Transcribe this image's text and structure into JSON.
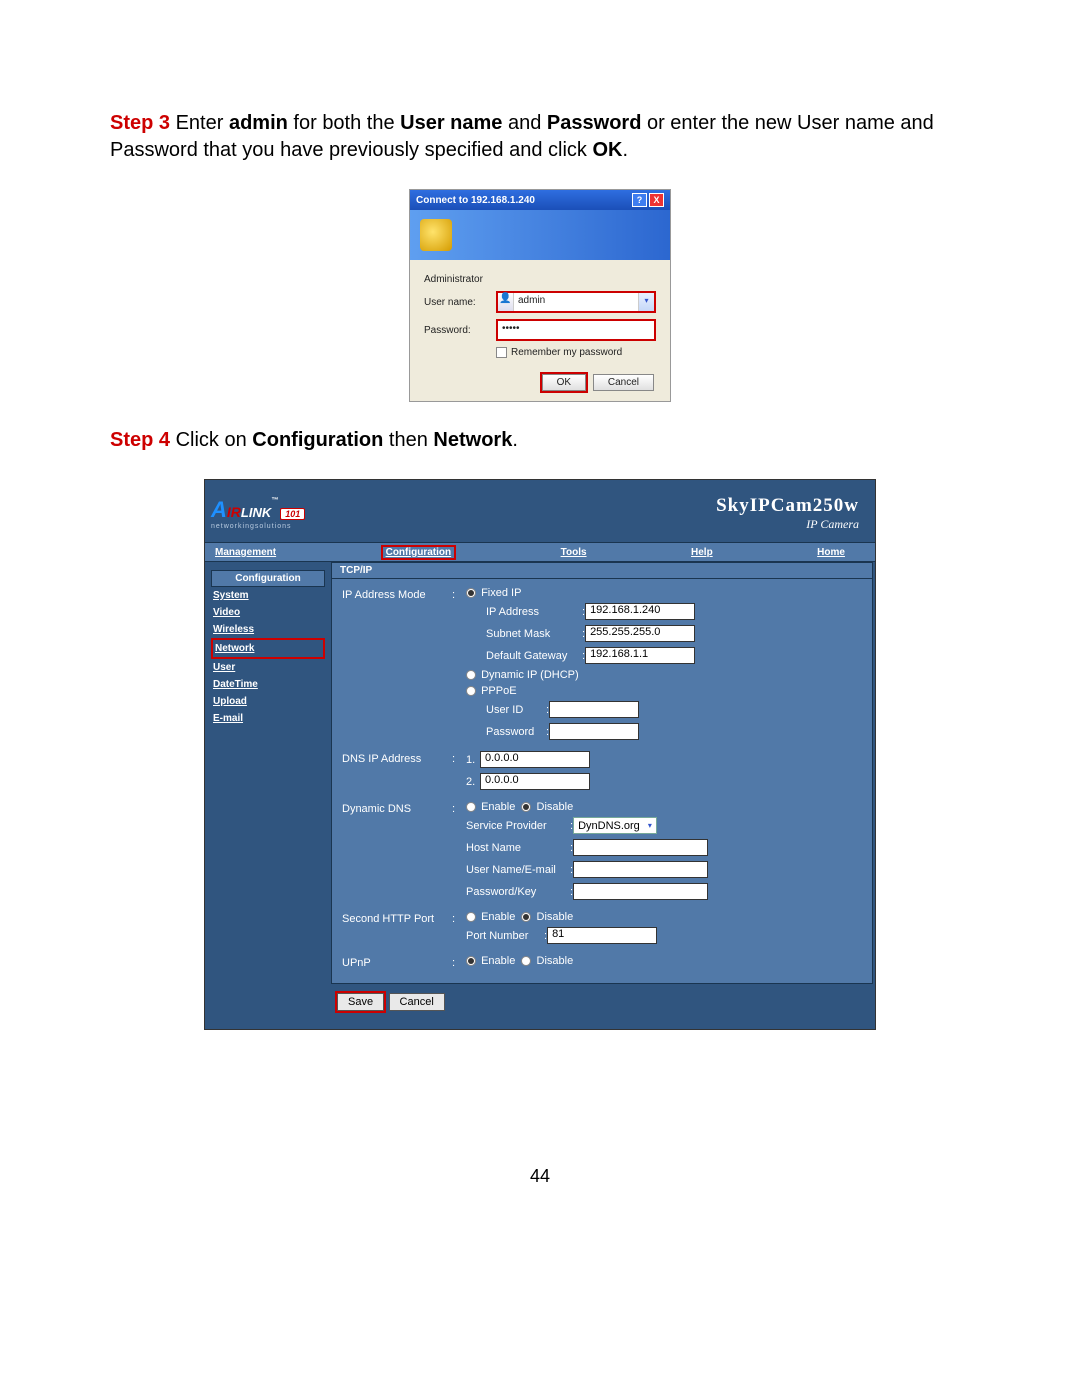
{
  "step3": {
    "label": "Step 3",
    "line1": " Enter ",
    "admin": "admin",
    "line2": " for both the ",
    "un": "User name",
    "line3": " and ",
    "pw": "Password",
    "line4": " or enter the new User name and Password that you have previously specified and click ",
    "ok": "OK",
    "period": "."
  },
  "dlg": {
    "title": "Connect to 192.168.1.240",
    "help": "?",
    "close": "X",
    "admin_hdr": "Administrator",
    "user_lbl": "User name:",
    "user_val": "admin",
    "pw_lbl": "Password:",
    "pw_val": "•••••",
    "remember": "Remember my password",
    "ok": "OK",
    "cancel": "Cancel"
  },
  "step4": {
    "label": "Step 4",
    "t1": " Click on ",
    "conf": "Configuration",
    "t2": " then ",
    "net": "Network",
    "p": "."
  },
  "cfg": {
    "logo101": "101",
    "ns": "networkingsolutions",
    "sky": "SkyIPCam250w",
    "ipcam": "IP Camera",
    "nav": {
      "management": "Management",
      "configuration": "Configuration",
      "tools": "Tools",
      "help": "Help",
      "home": "Home"
    },
    "side": {
      "hdr": "Configuration",
      "system": "System",
      "video": "Video",
      "wireless": "Wireless",
      "network": "Network",
      "user": "User",
      "datetime": "DateTime",
      "upload": "Upload",
      "email": "E-mail"
    },
    "section": "TCP/IP",
    "rows": {
      "ipmode": "IP Address Mode",
      "fixed": "Fixed IP",
      "ipaddr_lbl": "IP Address",
      "ipaddr": "192.168.1.240",
      "subnet_lbl": "Subnet Mask",
      "subnet": "255.255.255.0",
      "gw_lbl": "Default Gateway",
      "gw": "192.168.1.1",
      "dhcp": "Dynamic IP (DHCP)",
      "pppoe": "PPPoE",
      "userid_lbl": "User ID",
      "pwd_lbl": "Password",
      "dns_lbl": "DNS IP Address",
      "dns1_pre": "1.",
      "dns1": "0.0.0.0",
      "dns2_pre": "2.",
      "dns2": "0.0.0.0",
      "ddns_lbl": "Dynamic DNS",
      "enable": "Enable",
      "disable": "Disable",
      "svc_lbl": "Service Provider",
      "svc": "DynDNS.org",
      "host_lbl": "Host Name",
      "usermail_lbl": "User Name/E-mail",
      "pwkey_lbl": "Password/Key",
      "http2_lbl": "Second HTTP Port",
      "portnum_lbl": "Port Number",
      "portnum": "81",
      "upnp_lbl": "UPnP"
    },
    "save": "Save",
    "cancel": "Cancel"
  },
  "page_num": "44"
}
